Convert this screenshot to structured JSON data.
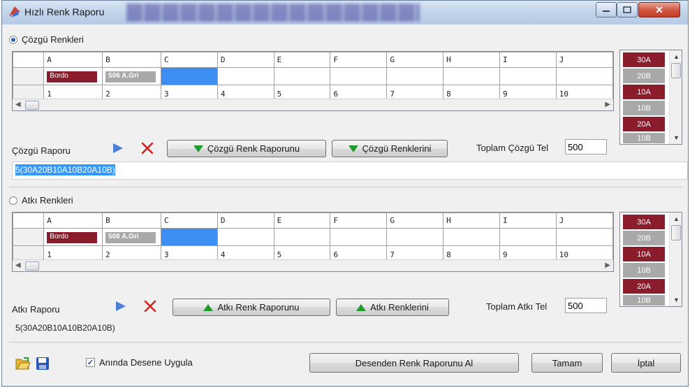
{
  "window": {
    "title": "Hızlı Renk Raporu"
  },
  "warp": {
    "radio_label": "Çözgü Renkleri",
    "selected": true,
    "columns": [
      "A",
      "B",
      "C",
      "D",
      "E",
      "F",
      "G",
      "H",
      "I",
      "J"
    ],
    "color_row": [
      {
        "text": "Bordo",
        "style": "bordo"
      },
      {
        "text": "506 A.Gri",
        "style": "gri"
      },
      {
        "text": "",
        "style": "selected"
      },
      {
        "text": "",
        "style": ""
      },
      {
        "text": "",
        "style": ""
      },
      {
        "text": "",
        "style": ""
      },
      {
        "text": "",
        "style": ""
      },
      {
        "text": "",
        "style": ""
      },
      {
        "text": "",
        "style": ""
      },
      {
        "text": "",
        "style": ""
      }
    ],
    "count_row": [
      "1",
      "2",
      "3",
      "4",
      "5",
      "6",
      "7",
      "8",
      "9",
      "10"
    ],
    "side_items": [
      {
        "text": "30A",
        "color": "red"
      },
      {
        "text": "20B",
        "color": "gray"
      },
      {
        "text": "10A",
        "color": "red"
      },
      {
        "text": "10B",
        "color": "gray"
      },
      {
        "text": "20A",
        "color": "red"
      },
      {
        "text": "10B",
        "color": "gray"
      }
    ],
    "report_label": "Çözgü Raporu",
    "btn_report": "Çözgü Renk Raporunu",
    "btn_colors": "Çözgü Renklerini",
    "total_label": "Toplam Çözgü Tel",
    "total_value": "500",
    "report_value": "5(30A20B10A10B20A10B)"
  },
  "weft": {
    "radio_label": "Atkı Renkleri",
    "selected": false,
    "columns": [
      "A",
      "B",
      "C",
      "D",
      "E",
      "F",
      "G",
      "H",
      "I",
      "J"
    ],
    "color_row": [
      {
        "text": "Bordo",
        "style": "bordo"
      },
      {
        "text": "506 A.Gri",
        "style": "gri"
      },
      {
        "text": "",
        "style": "selected"
      },
      {
        "text": "",
        "style": ""
      },
      {
        "text": "",
        "style": ""
      },
      {
        "text": "",
        "style": ""
      },
      {
        "text": "",
        "style": ""
      },
      {
        "text": "",
        "style": ""
      },
      {
        "text": "",
        "style": ""
      },
      {
        "text": "",
        "style": ""
      }
    ],
    "count_row": [
      "1",
      "2",
      "3",
      "4",
      "5",
      "6",
      "7",
      "8",
      "9",
      "10"
    ],
    "side_items": [
      {
        "text": "30A",
        "color": "red"
      },
      {
        "text": "20B",
        "color": "gray"
      },
      {
        "text": "10A",
        "color": "red"
      },
      {
        "text": "10B",
        "color": "gray"
      },
      {
        "text": "20A",
        "color": "red"
      },
      {
        "text": "10B",
        "color": "gray"
      }
    ],
    "report_label": "Atkı Raporu",
    "btn_report": "Atkı Renk Raporunu",
    "btn_colors": "Atkı Renklerini",
    "total_label": "Toplam Atkı Tel",
    "total_value": "500",
    "report_value": "5(30A20B10A10B20A10B)"
  },
  "footer": {
    "apply_checkbox_label": "Anında Desene Uygula",
    "apply_checked": true,
    "btn_get_report": "Desenden Renk Raporunu Al",
    "btn_ok": "Tamam",
    "btn_cancel": "İptal"
  },
  "colors": {
    "bordo": "#8b1c2b",
    "gray": "#a9a9a9",
    "selection": "#3d8ef2",
    "green_arrow": "#1f9a2e",
    "red_x": "#d21f1f",
    "play_blue": "#4a7fd6"
  }
}
